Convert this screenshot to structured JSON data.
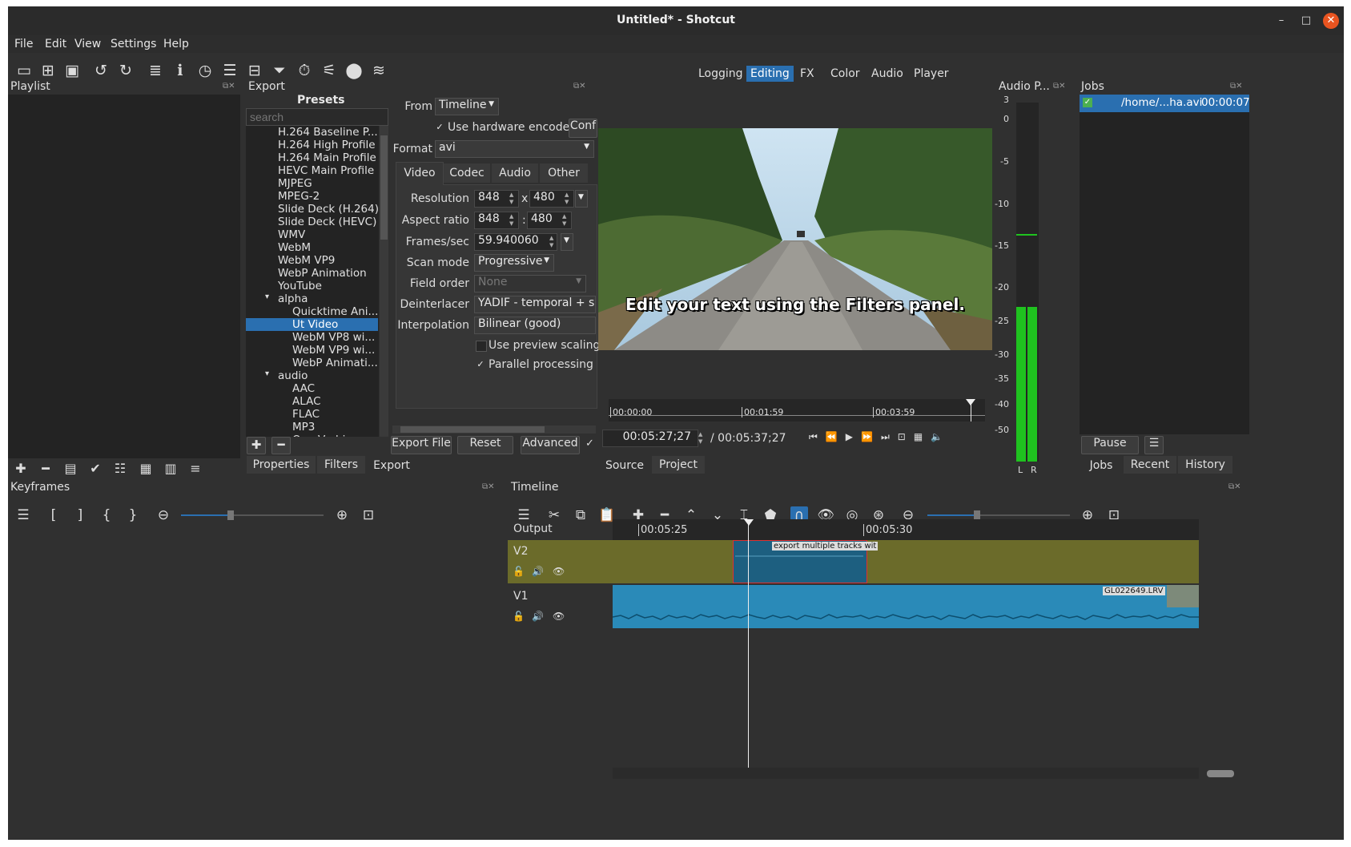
{
  "window": {
    "title": "Untitled* - Shotcut",
    "minimize": "–",
    "maximize": "□",
    "close": "✕"
  },
  "menu": [
    "File",
    "Edit",
    "View",
    "Settings",
    "Help"
  ],
  "toolbar_icons": [
    "open-icon",
    "open-other-icon",
    "save-icon",
    "undo-icon",
    "redo-icon",
    "peak-meter-icon",
    "properties-icon",
    "recent-icon",
    "playlist-icon",
    "timeline-icon",
    "filters-icon",
    "keyframes-icon",
    "markers-icon",
    "export-icon",
    "jobs-icon"
  ],
  "layouts": [
    "Logging",
    "Editing",
    "FX",
    "Color",
    "Audio",
    "Player"
  ],
  "playlist": {
    "title": "Playlist"
  },
  "export": {
    "title": "Export",
    "presets_header": "Presets",
    "search_placeholder": "search",
    "presets": [
      {
        "label": "H.264 Baseline P...",
        "indent": 1
      },
      {
        "label": "H.264 High Profile",
        "indent": 1
      },
      {
        "label": "H.264 Main Profile",
        "indent": 1
      },
      {
        "label": "HEVC Main Profile",
        "indent": 1
      },
      {
        "label": "MJPEG",
        "indent": 1
      },
      {
        "label": "MPEG-2",
        "indent": 1
      },
      {
        "label": "Slide Deck (H.264)",
        "indent": 1
      },
      {
        "label": "Slide Deck (HEVC)",
        "indent": 1
      },
      {
        "label": "WMV",
        "indent": 1
      },
      {
        "label": "WebM",
        "indent": 1
      },
      {
        "label": "WebM VP9",
        "indent": 1
      },
      {
        "label": "WebP Animation",
        "indent": 1
      },
      {
        "label": "YouTube",
        "indent": 1
      },
      {
        "label": "alpha",
        "indent": 1,
        "group": true
      },
      {
        "label": "Quicktime Ani...",
        "indent": 2
      },
      {
        "label": "Ut Video",
        "indent": 2,
        "selected": true
      },
      {
        "label": "WebM VP8 wi...",
        "indent": 2
      },
      {
        "label": "WebM VP9 wi...",
        "indent": 2
      },
      {
        "label": "WebP Animati...",
        "indent": 2
      },
      {
        "label": "audio",
        "indent": 1,
        "group": true
      },
      {
        "label": "AAC",
        "indent": 2
      },
      {
        "label": "ALAC",
        "indent": 2
      },
      {
        "label": "FLAC",
        "indent": 2
      },
      {
        "label": "MP3",
        "indent": 2
      },
      {
        "label": "Ogg Vorbis",
        "indent": 2
      }
    ],
    "from_label": "From",
    "from_value": "Timeline",
    "hw_encoder_label": "Use hardware encoder",
    "hw_encoder_button": "Conf",
    "format_label": "Format",
    "format_value": "avi",
    "tabs": [
      "Video",
      "Codec",
      "Audio",
      "Other"
    ],
    "resolution_label": "Resolution",
    "resolution_w": "848",
    "resolution_h": "480",
    "aspect_label": "Aspect ratio",
    "aspect_w": "848",
    "aspect_h": "480",
    "fps_label": "Frames/sec",
    "fps_value": "59.940060",
    "scan_label": "Scan mode",
    "scan_value": "Progressive",
    "field_label": "Field order",
    "field_value": "None",
    "deint_label": "Deinterlacer",
    "deint_value": "YADIF - temporal + spat",
    "interp_label": "Interpolation",
    "interp_value": "Bilinear (good)",
    "preview_scaling_label": "Use preview scaling",
    "parallel_label": "Parallel processing",
    "x_sep": "x",
    "colon_sep": ":",
    "buttons": {
      "export_file": "Export File",
      "reset": "Reset",
      "advanced": "Advanced"
    }
  },
  "bottom_tabs_left": [
    "Properties",
    "Filters",
    "Export"
  ],
  "player": {
    "overlay_text": "Edit your text using the Filters panel.",
    "ruler": [
      "00:00:00",
      "00:01:59",
      "00:03:59"
    ],
    "position": "00:05:27;27",
    "duration": "/ 00:05:37;27",
    "tabs": [
      "Source",
      "Project"
    ]
  },
  "audio_peak": {
    "title": "Audio P...",
    "scale": [
      "3",
      "0",
      "-5",
      "-10",
      "-15",
      "-20",
      "-25",
      "-30",
      "-35",
      "-40",
      "-50"
    ],
    "channels": [
      "L",
      "R"
    ],
    "level_db": -20
  },
  "jobs": {
    "title": "Jobs",
    "job_name": "/home/...ha.avi",
    "job_time": "00:00:07",
    "pause": "Pause",
    "menu": "☰",
    "tabs": [
      "Jobs",
      "Recent",
      "History"
    ]
  },
  "keyframes": {
    "title": "Keyframes"
  },
  "timeline": {
    "title": "Timeline",
    "output_label": "Output",
    "ruler": [
      "00:05:25",
      "00:05:30"
    ],
    "tracks": [
      {
        "name": "V2",
        "clip": "export multiple tracks wit"
      },
      {
        "name": "V1",
        "clip": "GL022649.LRV"
      }
    ]
  },
  "colors": {
    "accent": "#2a6fb0",
    "v2_track": "#6b6b2a",
    "v1_clip": "#2a8ab8",
    "meter": "#1fc21f",
    "close": "#e95420"
  }
}
